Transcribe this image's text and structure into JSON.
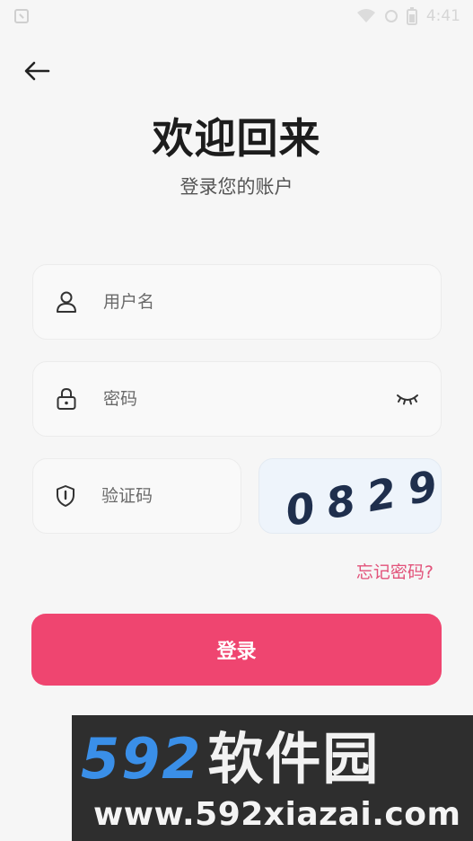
{
  "status_bar": {
    "time": "4:41"
  },
  "header": {
    "title": "欢迎回来",
    "subtitle": "登录您的账户"
  },
  "form": {
    "username_placeholder": "用户名",
    "password_placeholder": "密码",
    "captcha_placeholder": "验证码",
    "captcha_code": "0829",
    "forgot_label": "忘记密码?",
    "login_label": "登录"
  },
  "watermark": {
    "brand_number": "592",
    "brand_name": "软件园",
    "url": "www.592xiazai.com"
  },
  "colors": {
    "accent": "#ef4570",
    "link": "#e2527a",
    "background": "#f6f6f6"
  },
  "icons": [
    "back-arrow-icon",
    "user-icon",
    "lock-icon",
    "eye-closed-icon",
    "shield-icon"
  ]
}
